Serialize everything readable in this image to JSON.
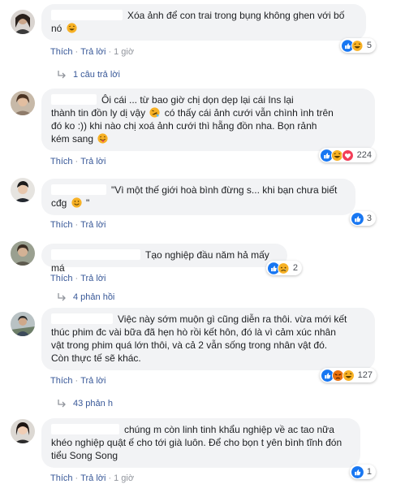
{
  "actions": {
    "like": "Thích",
    "reply": "Trả lời",
    "dot": "·"
  },
  "comments": [
    {
      "text_1": "Xóa ảnh để con trai trong bụng không ghen với bố",
      "text_2": "nó",
      "time": "1 giờ",
      "reaction_count": "5",
      "reactions": [
        "like-icon",
        "haha-icon"
      ],
      "replies_label": "1 câu trả lời"
    },
    {
      "text_1": "Ôi cái ...  từ bao giờ chị dọn dẹp lại cái Ins lại",
      "text_2": "thành tin đồn ly dị vậy",
      "text_2b": "có thấy cái ảnh cưới vẫn chình ình trên",
      "text_3": "đó ko :)) khi nào chị xoá ảnh cưới thì hẵng đồn nha. Bọn rảnh",
      "text_4": "kém sang",
      "time": "",
      "reaction_count": "224",
      "reactions": [
        "like-icon",
        "haha-icon",
        "love-icon"
      ]
    },
    {
      "text_1": "\"Vì một thế giới hoà bình đừng s... khi bạn chưa biết",
      "text_2": "cđg",
      "text_2b": "\"",
      "time": "",
      "reaction_count": "3",
      "reactions": [
        "like-icon"
      ]
    },
    {
      "text_1": "Tạo nghiệp đầu năm hả mấy má",
      "time": "",
      "reaction_count": "2",
      "reactions": [
        "like-icon",
        "sad-icon"
      ],
      "replies_label": "4 phản hồi"
    },
    {
      "text_1": "Việc này sớm muộn gì cũng diễn ra thôi. vừa mới kết",
      "text_2": "thúc phim đc vài bữa đã hẹn hò rồi kết hôn, đó là vì cảm xúc nhân",
      "text_3": "vật trong phim quá lớn thôi, và cả 2 vẫn sống trong nhân vật đó.",
      "text_4": "Còn thực tế sẽ khác.",
      "time": "",
      "reaction_count": "127",
      "reactions": [
        "like-icon",
        "angry-icon",
        "haha-icon"
      ],
      "replies_label": "43 phản h"
    },
    {
      "text_1": "chúng m còn linh tinh khẩu nghiệp về ac tao nữa",
      "text_2": "khéo nghiệp quật ế cho tới già luôn. Để cho bọn t yên bình tĩnh đón",
      "text_3": "tiểu Song Song",
      "time": "1 giờ",
      "reaction_count": "1",
      "reactions": [
        "like-icon"
      ]
    }
  ],
  "colors": {
    "link": "#385898",
    "bubble": "#f2f3f5",
    "like": "#1877f2",
    "haha": "#f7b125",
    "love": "#f33e58",
    "angry": "#e9710f"
  }
}
